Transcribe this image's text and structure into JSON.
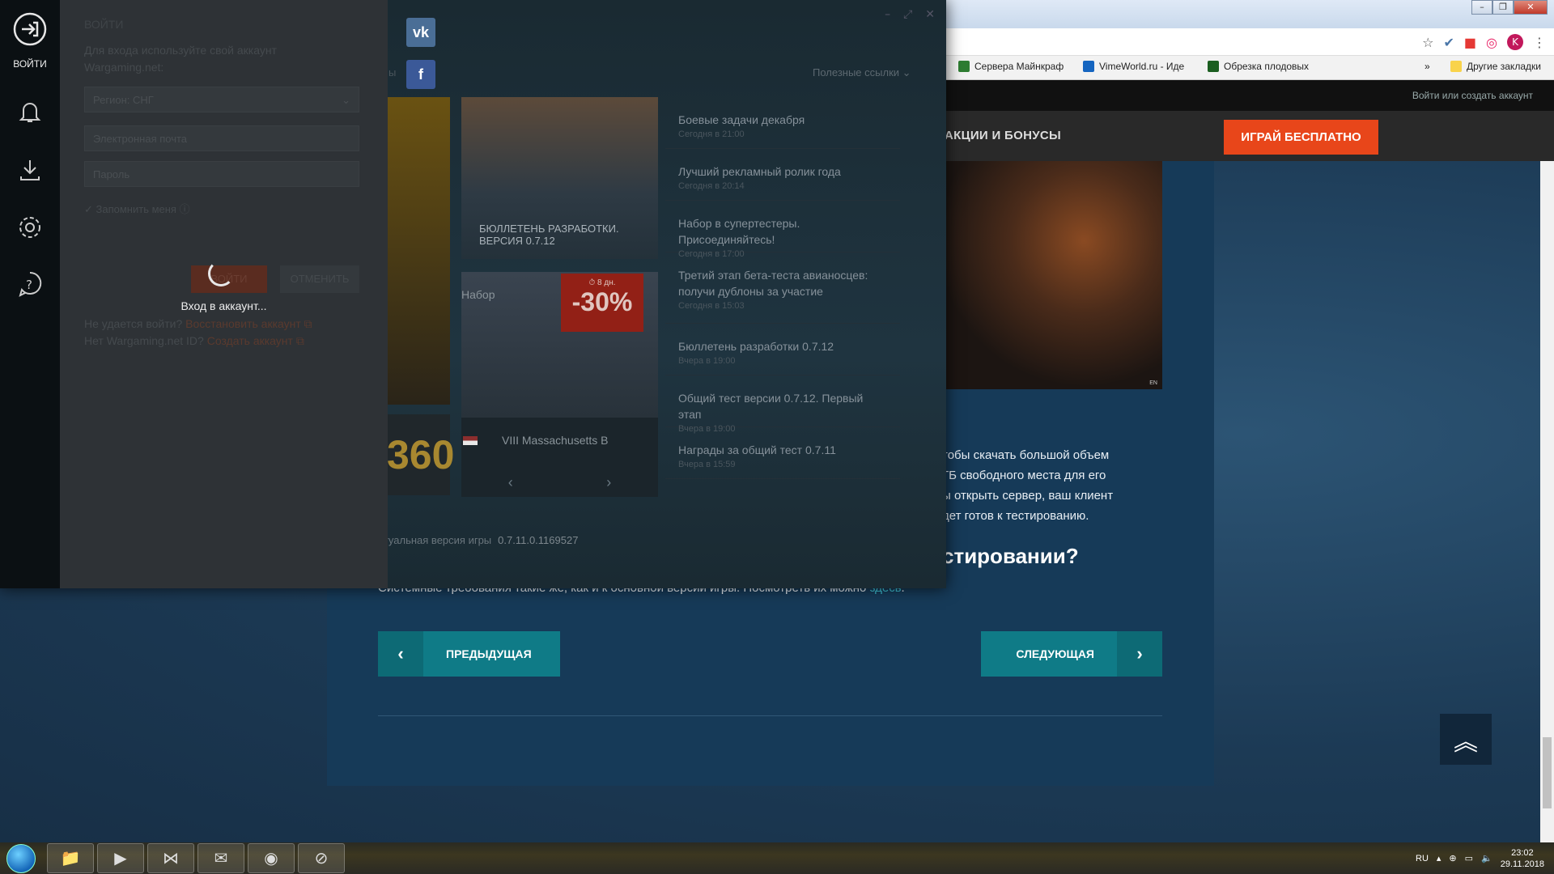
{
  "browser": {
    "profile_initial": "K",
    "bookmarks": [
      {
        "label": "Сервера Майнкраф",
        "color": "#2e7d32"
      },
      {
        "label": "VimeWorld.ru - Иде",
        "color": "#1565c0"
      },
      {
        "label": "Обрезка плодовых",
        "color": "#1b5e20"
      }
    ],
    "bookmarks_more": "»",
    "other_bookmarks": "Другие закладки"
  },
  "site": {
    "login_link": "Войти или создать аккаунт",
    "nav_promo": "АКЦИИ И БОНУСЫ",
    "play_button": "ИГРАЙ БЕСПЛАТНО",
    "hero_locale": "EN",
    "article_lines": [
      "тобы скачать большой объем",
      "ГБ свободного места для его",
      "ы открыть сервер, ваш клиент",
      "дет готов к тестированию."
    ],
    "article_heading": "стировании?",
    "sysreq_text": "Системные требования такие же, как и к основной версии игры. Посмотреть их можно",
    "sysreq_link": "здесь",
    "prev_button": "ПРЕДЫДУЩАЯ",
    "next_button": "СЛЕДУЮЩАЯ"
  },
  "launcher": {
    "sidenav_login": "ВОЙТИ",
    "useful_links": "Полезные ссылки",
    "tab_fragment": "ы",
    "news_card_caption": "БЮЛЛЕТЕНЬ РАЗРАБОТКИ.\nВЕРСИЯ 0.7.12",
    "tile_360": "360",
    "offer": {
      "label": "Набор",
      "timer": "⏱ 8 дн.",
      "discount": "-30%",
      "ship": "VIII  Massachusetts B"
    },
    "news": [
      {
        "title": "Боевые задачи декабря",
        "date": "Сегодня в 21:00"
      },
      {
        "title": "Лучший рекламный ролик года",
        "date": "Сегодня в 20:14"
      },
      {
        "title": "Набор в супертестеры. Присоединяйтесь!",
        "date": "Сегодня в 17:00"
      },
      {
        "title": "Третий этап бета-теста авианосцев: получи дублоны за участие",
        "date": "Сегодня в 15:03"
      },
      {
        "title": "Бюллетень разработки 0.7.12",
        "date": "Вчера в 19:00"
      },
      {
        "title": "Общий тест версии 0.7.12. Первый этап",
        "date": "Вчера в 19:00"
      },
      {
        "title": "Награды за общий тест 0.7.11",
        "date": "Вчера в 15:59"
      }
    ],
    "version_label": "ктуальная версия игры",
    "version_value": "0.7.11.0.1169527"
  },
  "login": {
    "title": "ВОЙТИ",
    "hint": "Для входа используйте свой аккаунт Wargaming.net:",
    "region_label": "Регион:",
    "region_value": "СНГ",
    "email_placeholder": "Электронная почта",
    "password_placeholder": "Пароль",
    "remember": "✓  Запомнить меня",
    "login_button": "ВОЙТИ",
    "cancel_button": "ОТМЕНИТЬ",
    "loading": "Вход в аккаунт...",
    "cant_login": "Не удается войти?",
    "restore": "Восстановить аккаунт ⧉",
    "no_account": "Нет Wargaming.net ID?",
    "create": "Создать аккаунт ⧉"
  },
  "taskbar": {
    "language": "RU",
    "time": "23:02",
    "date": "29.11.2018"
  }
}
